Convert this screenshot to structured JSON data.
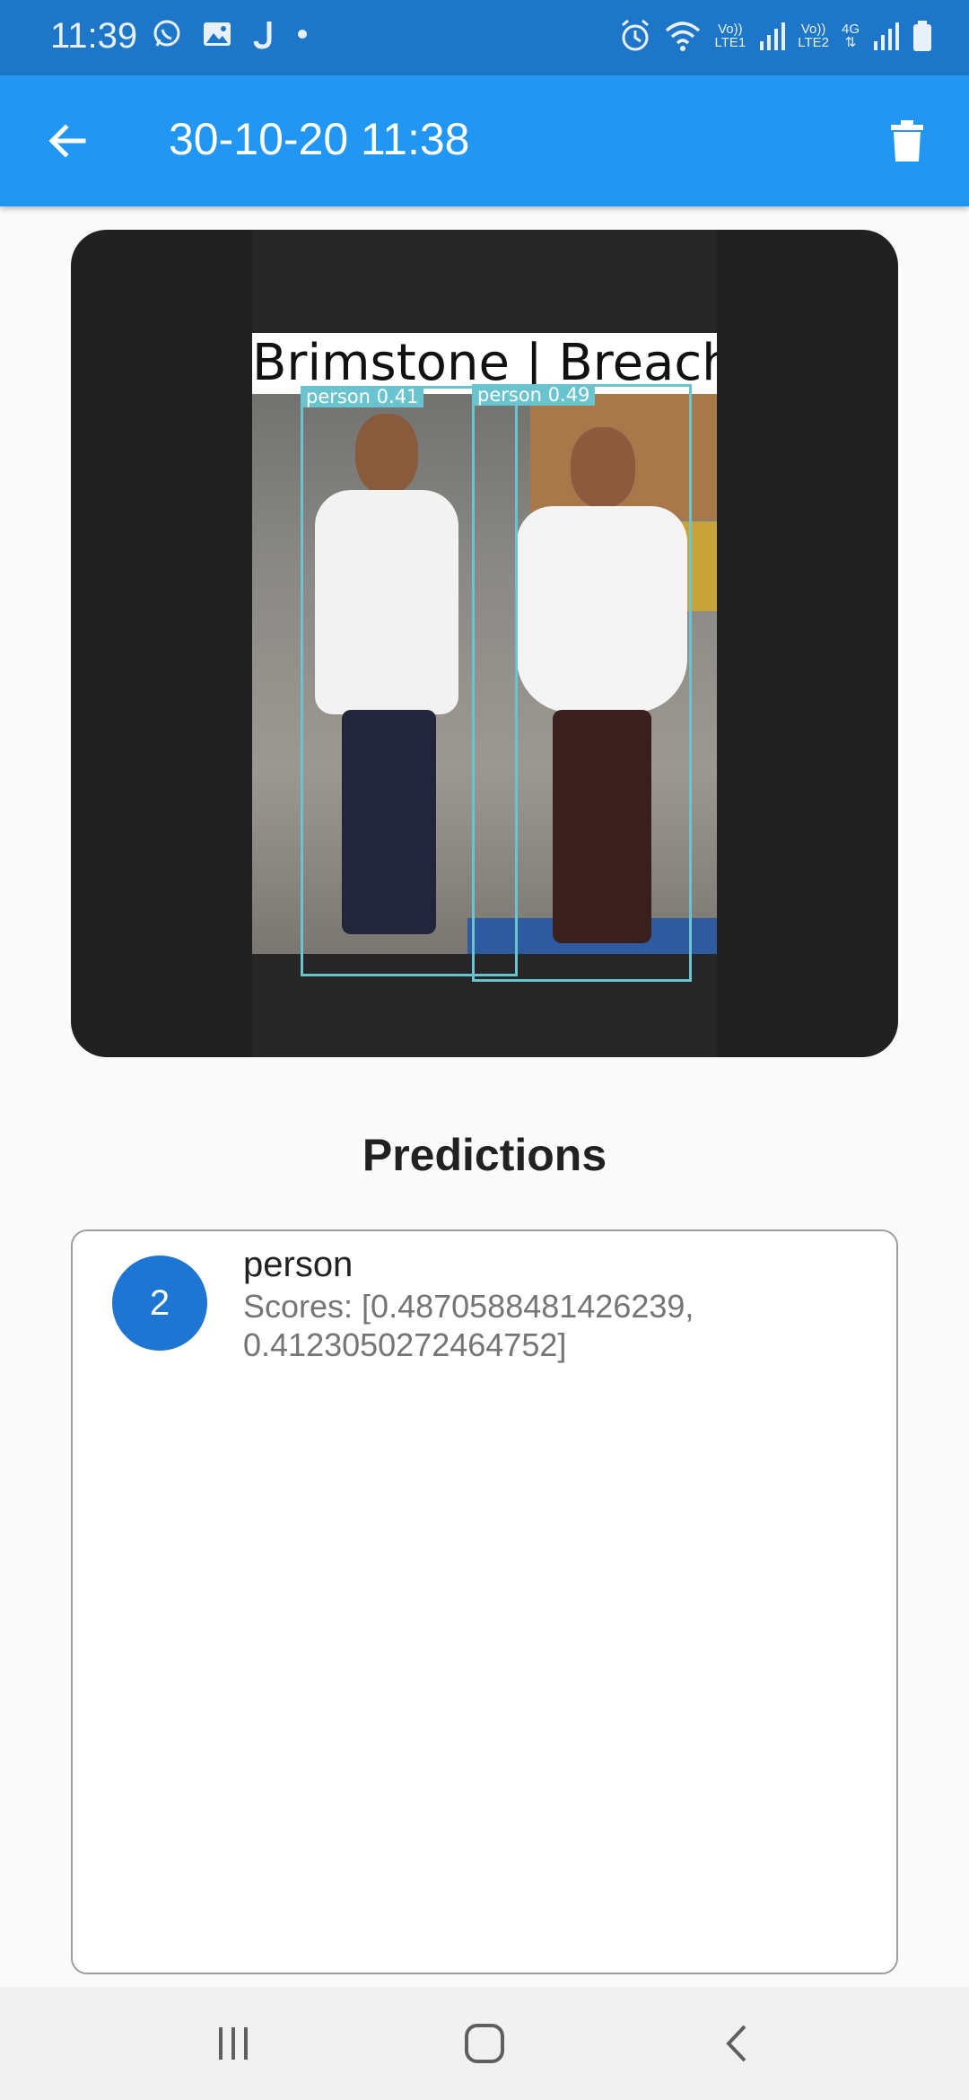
{
  "status_bar": {
    "time": "11:39",
    "left_icons": [
      "whatsapp-icon",
      "gallery-icon",
      "j-app-icon",
      "dot-icon"
    ],
    "right_icons": [
      "alarm-icon",
      "wifi-icon",
      "volte-lte1-icon",
      "signal-1-icon",
      "volte-lte2-icon",
      "4g-icon",
      "signal-2-icon",
      "battery-icon"
    ],
    "volte1_label": "Vo))",
    "lte1_label": "LTE1",
    "volte2_label": "Vo))",
    "lte2_label": "LTE2",
    "net_label": "4G"
  },
  "app_bar": {
    "title": "30-10-20 11:38",
    "back_icon": "arrow-back-icon",
    "delete_icon": "trash-icon",
    "color": "#2196f3"
  },
  "image_view": {
    "banner_text": "Brimstone | Breach",
    "detections": [
      {
        "label": "person 0.41"
      },
      {
        "label": "person 0.49"
      }
    ],
    "box_color": "#6ac4d0"
  },
  "predictions": {
    "heading": "Predictions",
    "items": [
      {
        "count": "2",
        "label": "person",
        "scores": "Scores: [0.4870588481426239, 0.4123050272464752]"
      }
    ],
    "avatar_color": "#1e76d2"
  },
  "nav_bar": {
    "icons": [
      "recents-icon",
      "home-icon",
      "back-nav-icon"
    ]
  }
}
